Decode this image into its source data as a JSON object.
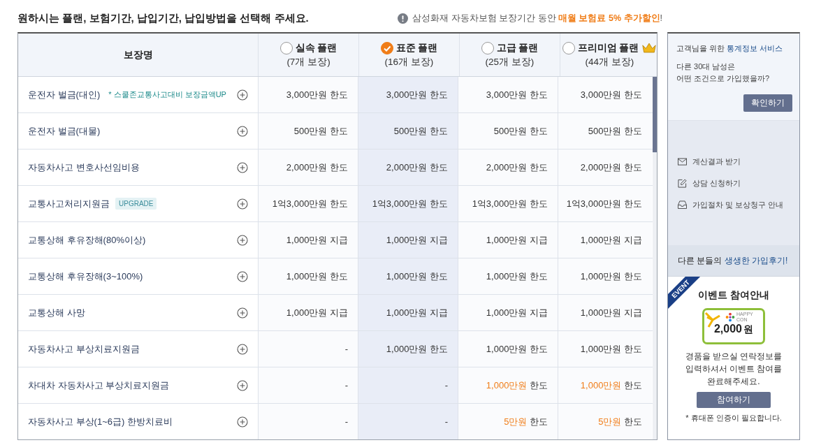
{
  "heading": "원하시는 플랜, 보험기간, 납입기간, 납입방법을 선택해 주세요.",
  "notice": {
    "prefix": "삼성화재 자동차보험 보장기간 동안 ",
    "accent": "매월 보험료 5% 추가할인",
    "suffix": "!"
  },
  "table": {
    "name_header": "보장명",
    "plans": [
      {
        "name": "실속 플랜",
        "count": "(7개 보장)",
        "selected": false,
        "crown": false
      },
      {
        "name": "표준 플랜",
        "count": "(16개 보장)",
        "selected": true,
        "crown": false
      },
      {
        "name": "고급 플랜",
        "count": "(25개 보장)",
        "selected": false,
        "crown": false
      },
      {
        "name": "프리미엄 플랜",
        "count": "(44개 보장)",
        "selected": false,
        "crown": true
      }
    ],
    "rows": [
      {
        "name": "운전자 벌금(대인)",
        "note": "* 스쿨존교통사고대비 보장금액UP",
        "cells": [
          "3,000만원 한도",
          "3,000만원 한도",
          "3,000만원 한도",
          "3,000만원 한도"
        ]
      },
      {
        "name": "운전자 벌금(대물)",
        "cells": [
          "500만원 한도",
          "500만원 한도",
          "500만원 한도",
          "500만원 한도"
        ]
      },
      {
        "name": "자동차사고 변호사선임비용",
        "cells": [
          "2,000만원 한도",
          "2,000만원 한도",
          "2,000만원 한도",
          "2,000만원 한도"
        ]
      },
      {
        "name": "교통사고처리지원금",
        "badge": "UPGRADE",
        "cells": [
          "1억3,000만원 한도",
          "1억3,000만원 한도",
          "1억3,000만원 한도",
          "1억3,000만원 한도"
        ]
      },
      {
        "name": "교통상해 후유장해(80%이상)",
        "cells": [
          "1,000만원 지급",
          "1,000만원 지급",
          "1,000만원 지급",
          "1,000만원 지급"
        ]
      },
      {
        "name": "교통상해 후유장해(3~100%)",
        "cells": [
          "1,000만원 한도",
          "1,000만원 한도",
          "1,000만원 한도",
          "1,000만원 한도"
        ]
      },
      {
        "name": "교통상해 사망",
        "cells": [
          "1,000만원 지급",
          "1,000만원 지급",
          "1,000만원 지급",
          "1,000만원 지급"
        ]
      },
      {
        "name": "자동차사고 부상치료지원금",
        "cells": [
          "-",
          "1,000만원 한도",
          "1,000만원 한도",
          "1,000만원 한도"
        ]
      },
      {
        "name": "차대차 자동차사고 부상치료지원금",
        "cells": [
          "-",
          "-",
          {
            "accent": "1,000만원",
            "text": " 한도"
          },
          {
            "accent": "1,000만원",
            "text": " 한도"
          }
        ]
      },
      {
        "name": "자동차사고 부상(1~6급) 한방치료비",
        "cells": [
          "-",
          "-",
          {
            "accent": "5만원",
            "text": " 한도"
          },
          {
            "accent": "5만원",
            "text": " 한도"
          }
        ]
      }
    ]
  },
  "sidebar": {
    "stats": {
      "title_prefix": "고객님을 위한 ",
      "title_accent": "통계정보 서비스",
      "question": [
        "다른 30대 남성은",
        "어떤 조건으로 가입했을까?"
      ],
      "button": "확인하기"
    },
    "links": [
      {
        "kind": "mail",
        "label": "계산결과 받기"
      },
      {
        "kind": "edit",
        "label": "상담 신청하기"
      },
      {
        "kind": "guide",
        "label": "가입절차 및 보상청구 안내"
      }
    ],
    "review": {
      "prefix": "다른 분들의 ",
      "accent": "생생한 가입후기!"
    },
    "event": {
      "ribbon": "EVENT",
      "title": "이벤트 참여안내",
      "logo": "HAPPY CON",
      "amount": "2,000",
      "unit": "원",
      "message": [
        "경품을 받으실 연락정보를",
        "입력하셔서 이벤트 참여를",
        "완료해주세요."
      ],
      "button": "참여하기",
      "footnote": "* 휴대폰 인증이 필요합니다."
    }
  }
}
